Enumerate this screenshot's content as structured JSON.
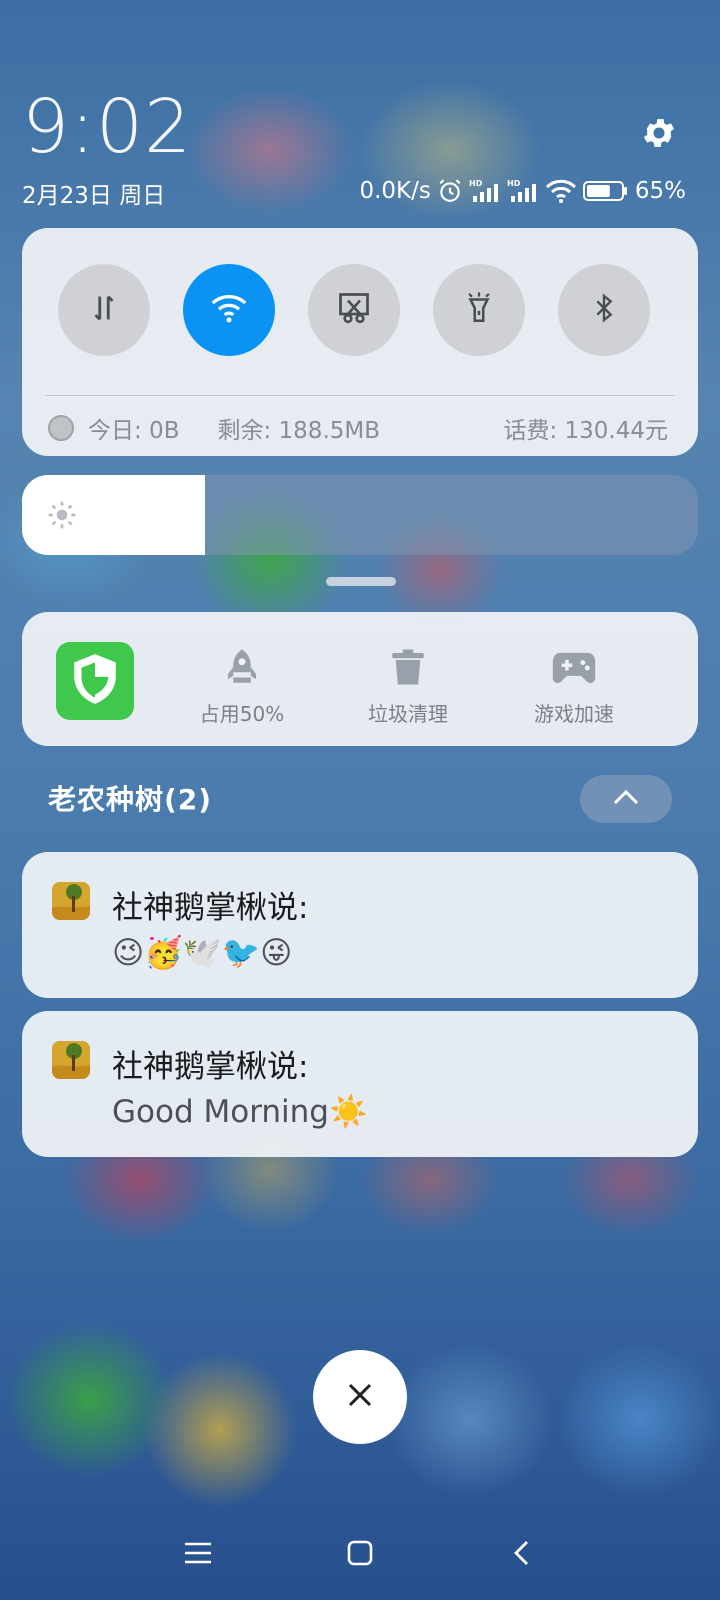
{
  "status": {
    "time": "9:02",
    "date": "2月23日 周日",
    "net_speed": "0.0K/s",
    "battery_percent": 65,
    "battery_percent_label": "65%"
  },
  "quick_settings": {
    "tiles": [
      {
        "name": "mobile-data",
        "icon": "data-arrows-icon",
        "active": false
      },
      {
        "name": "wifi",
        "icon": "wifi-icon",
        "active": true
      },
      {
        "name": "screenshot",
        "icon": "screenshot-scissors-icon",
        "active": false
      },
      {
        "name": "flashlight",
        "icon": "flashlight-icon",
        "active": false
      },
      {
        "name": "bluetooth",
        "icon": "bluetooth-icon",
        "active": false
      }
    ],
    "data_usage": {
      "today": "今日: 0B",
      "remaining": "剩余: 188.5MB",
      "balance": "话费: 130.44元"
    }
  },
  "brightness": {
    "level": 0.27
  },
  "tools": {
    "shield_icon": "security-shield-icon",
    "items": [
      {
        "label": "占用50%",
        "icon": "rocket-icon"
      },
      {
        "label": "垃圾清理",
        "icon": "trash-icon"
      },
      {
        "label": "游戏加速",
        "icon": "gamepad-icon"
      }
    ]
  },
  "notification_group": {
    "title": "老农种树(2)",
    "notifications": [
      {
        "sender": "社神鹅掌楸说:",
        "message": "😉🥳🕊️🐦😜"
      },
      {
        "sender": "社神鹅掌楸说:",
        "message": "Good Morning☀️"
      }
    ]
  },
  "colors": {
    "accent": "#0a92f5",
    "shield_green": "#3fc84c"
  }
}
